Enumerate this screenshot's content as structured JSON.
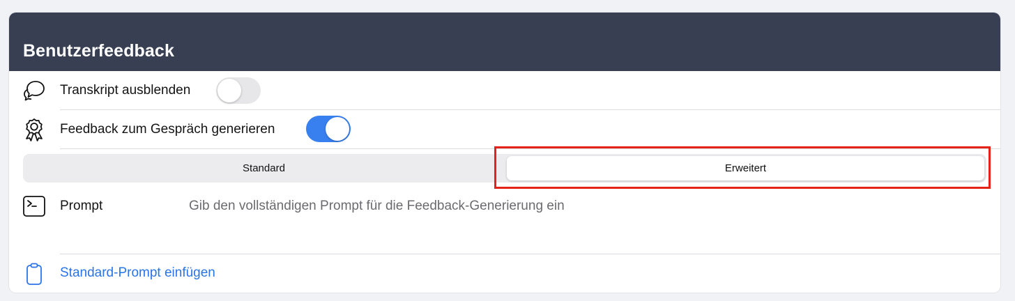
{
  "header": {
    "title": "Benutzerfeedback"
  },
  "rows": {
    "transcript": {
      "label": "Transkript ausblenden",
      "icon": "chat-bubble-icon",
      "toggle_on": false
    },
    "feedback": {
      "label": "Feedback zum Gespräch generieren",
      "icon": "award-badge-icon",
      "toggle_on": true
    }
  },
  "segmented": {
    "options": [
      "Standard",
      "Erweitert"
    ],
    "selected": "Erweitert"
  },
  "prompt": {
    "label": "Prompt",
    "icon": "terminal-icon",
    "placeholder": "Gib den vollständigen Prompt für die Feedback-Generierung ein"
  },
  "insert": {
    "label": "Standard-Prompt einfügen",
    "icon": "clipboard-icon"
  },
  "colors": {
    "header_bg": "#383f52",
    "accent": "#3880f0",
    "link": "#2a74e6",
    "highlight": "#e52218"
  }
}
